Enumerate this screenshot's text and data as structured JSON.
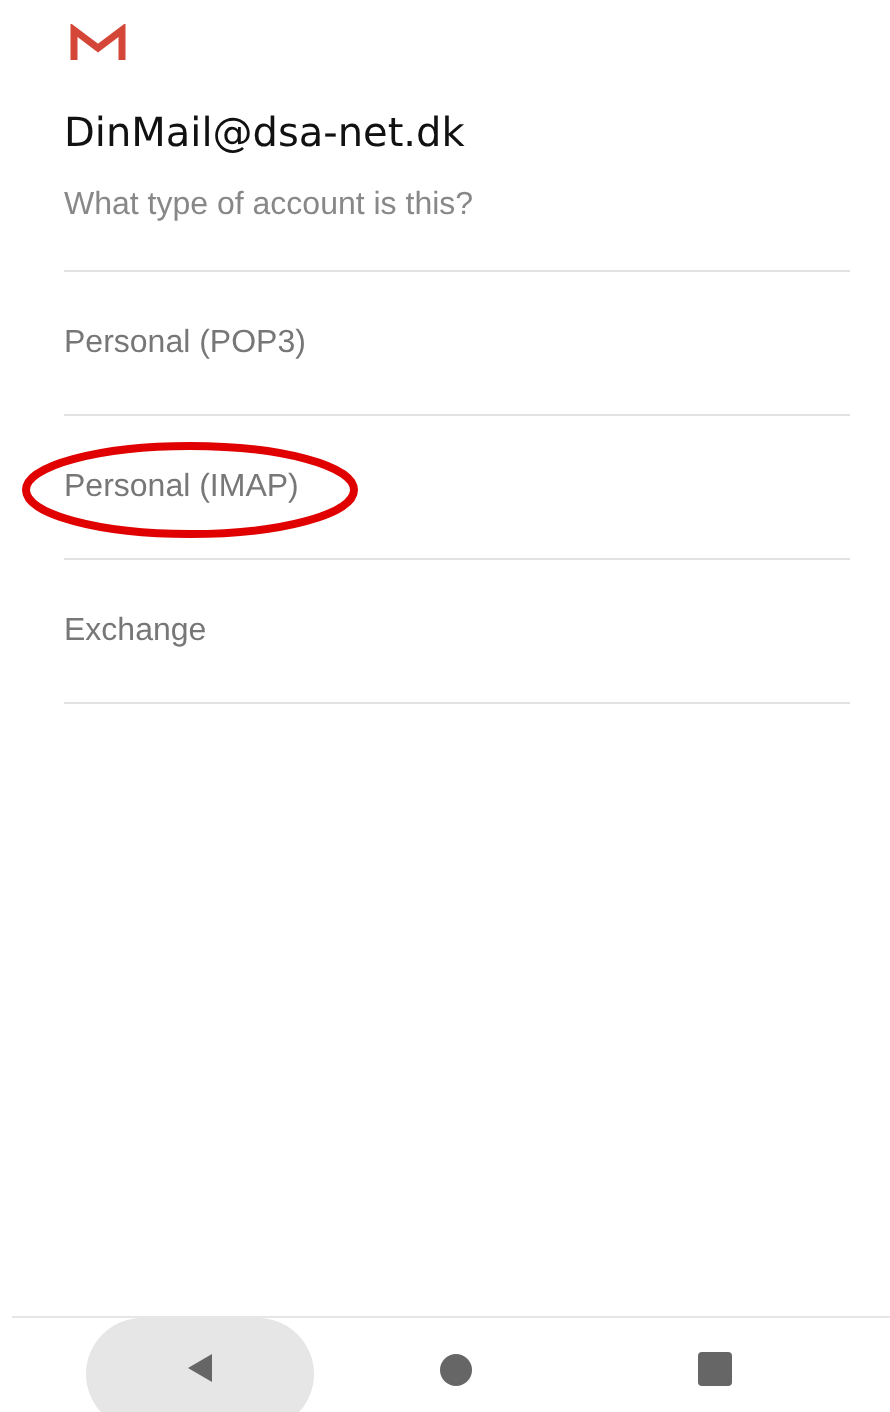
{
  "header": {
    "account": "DinMail@dsa-net.dk",
    "question": "What type of account is this?"
  },
  "options": [
    {
      "label": "Personal (POP3)",
      "circled": false
    },
    {
      "label": "Personal (IMAP)",
      "circled": true
    },
    {
      "label": "Exchange",
      "circled": false
    }
  ],
  "nav_bar": {
    "back_pressed": true
  }
}
